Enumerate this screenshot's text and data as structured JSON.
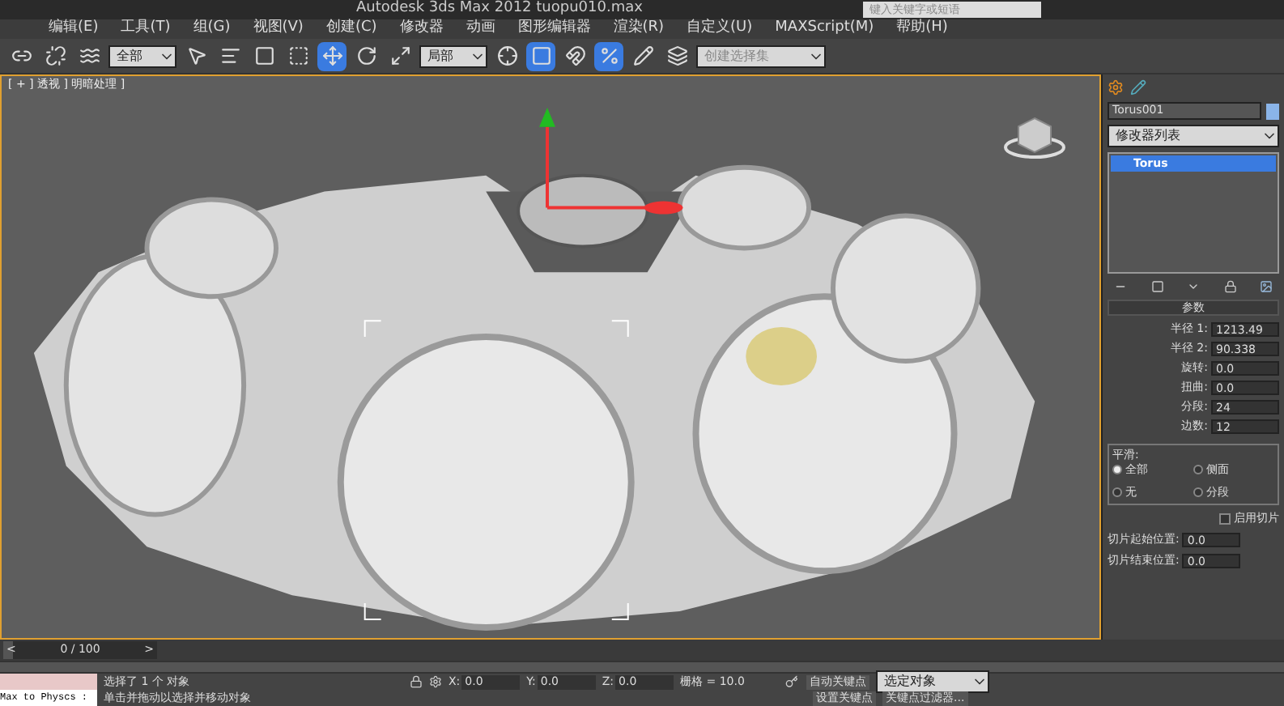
{
  "window": {
    "title": "Autodesk 3ds Max  2012    tuopu010.max",
    "search": {
      "placeholder": "键入关键字或短语"
    }
  },
  "menu": [
    "编辑(E)",
    "工具(T)",
    "组(G)",
    "视图(V)",
    "创建(C)",
    "修改器",
    "动画",
    "图形编辑器",
    "渲染(R)",
    "自定义(U)",
    "MAXScript(M)",
    "帮助(H)"
  ],
  "toolbar": {
    "selection_filter": "全部",
    "coordinate_system": "局部",
    "selection_set": {
      "placeholder": "创建选择集"
    },
    "tools": [
      {
        "selected": false
      },
      {
        "selected": false
      },
      {
        "selected": false
      },
      {
        "selected": false
      },
      {
        "selected": false
      },
      {
        "selected": false
      },
      {
        "selected": false
      },
      {
        "selected": true
      },
      {
        "selected": false
      },
      {
        "selected": false
      },
      {
        "selected": false
      },
      {
        "selected": true
      },
      {
        "selected": false
      },
      {
        "selected": true
      },
      {
        "selected": false
      },
      {
        "selected": false
      }
    ]
  },
  "viewport": {
    "label": "[ + ] 透视 ] 明暗处理 ]"
  },
  "command_panel": {
    "object_name": "Torus001",
    "modifier_list": "修改器列表",
    "stack": [
      {
        "label": "Torus",
        "selected": true
      }
    ],
    "rollout": "参数",
    "params": [
      {
        "label": "半径 1:",
        "value": "1213.49"
      },
      {
        "label": "半径 2:",
        "value": "90.338"
      },
      {
        "label": "旋转:",
        "value": "0.0"
      },
      {
        "label": "扭曲:",
        "value": "0.0"
      },
      {
        "label": "分段:",
        "value": "24"
      },
      {
        "label": "边数:",
        "value": "12"
      }
    ],
    "smoothing": {
      "title": "平滑:",
      "options": [
        {
          "label": "全部",
          "selected": true
        },
        {
          "label": "侧面",
          "selected": false
        },
        {
          "label": "无",
          "selected": false
        },
        {
          "label": "分段",
          "selected": false
        }
      ]
    },
    "slice_on": {
      "label": "启用切片",
      "checked": false
    },
    "slice_params": [
      {
        "label": "切片起始位置:",
        "value": "0.0"
      },
      {
        "label": "切片结束位置:",
        "value": "0.0"
      }
    ]
  },
  "time_slider": {
    "prev": "<",
    "position": "0 / 100",
    "next": ">",
    "level": 0
  },
  "status_bar": {
    "script_listener": "Max to Physcs :",
    "selection": "选择了 1 个 对象",
    "prompt": "单击并拖动以选择并移动对象",
    "coords": [
      {
        "label": "X:",
        "value": "0.0"
      },
      {
        "label": "Y:",
        "value": "0.0"
      },
      {
        "label": "Z:",
        "value": "0.0"
      }
    ],
    "grid": "栅格 = 10.0",
    "auto_key": "自动关键点",
    "key_mode": "选定对象",
    "set_key": "设置关键点",
    "key_filters": "关键点过滤器..."
  }
}
